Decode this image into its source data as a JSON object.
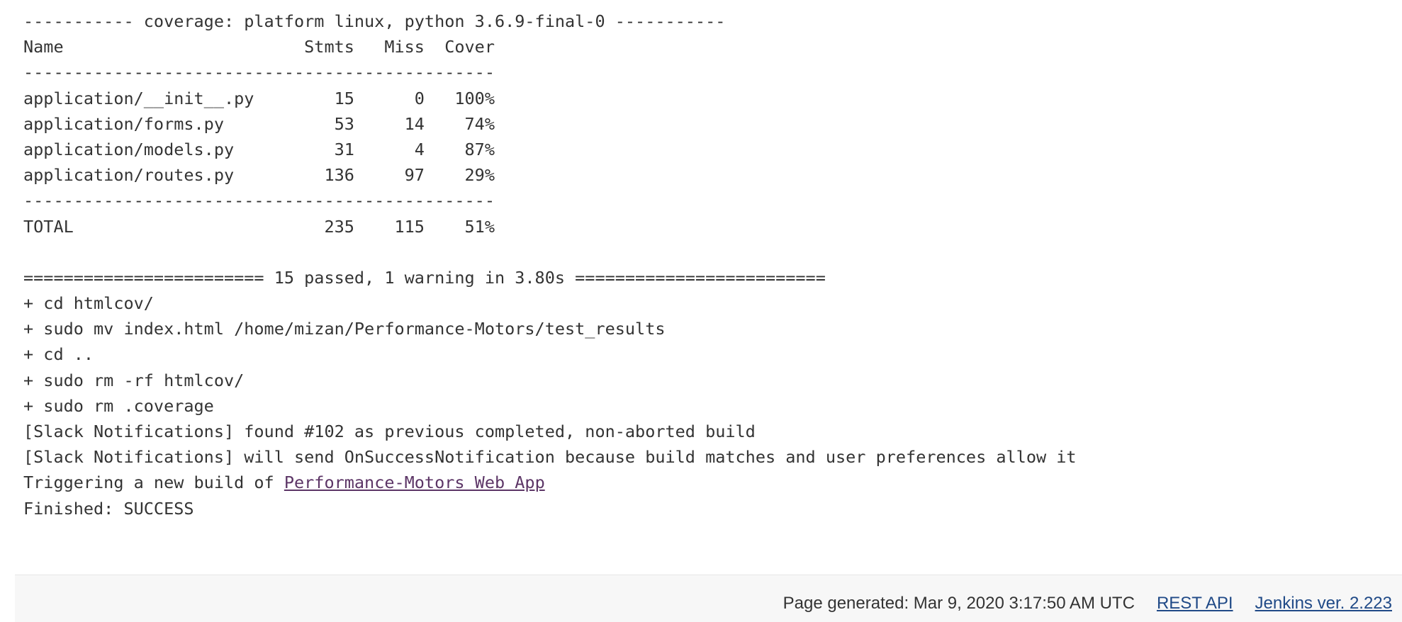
{
  "console": {
    "lines": [
      "----------- coverage: platform linux, python 3.6.9-final-0 -----------",
      "Name                        Stmts   Miss  Cover",
      "-----------------------------------------------",
      "application/__init__.py        15      0   100%",
      "application/forms.py           53     14    74%",
      "application/models.py          31      4    87%",
      "application/routes.py         136     97    29%",
      "-----------------------------------------------",
      "TOTAL                         235    115    51%",
      "",
      "======================== 15 passed, 1 warning in 3.80s =========================",
      "+ cd htmlcov/",
      "+ sudo mv index.html /home/mizan/Performance-Motors/test_results",
      "+ cd ..",
      "+ sudo rm -rf htmlcov/",
      "+ sudo rm .coverage",
      "[Slack Notifications] found #102 as previous completed, non-aborted build",
      "[Slack Notifications] will send OnSuccessNotification because build matches and user preferences allow it"
    ],
    "trigger_prefix": "Triggering a new build of ",
    "trigger_link": "Performance-Motors Web App",
    "finished": "Finished: SUCCESS"
  },
  "footer": {
    "generated": "Page generated: Mar 9, 2020 3:17:50 AM UTC",
    "rest_api": "REST API",
    "jenkins_version": "Jenkins ver. 2.223"
  }
}
